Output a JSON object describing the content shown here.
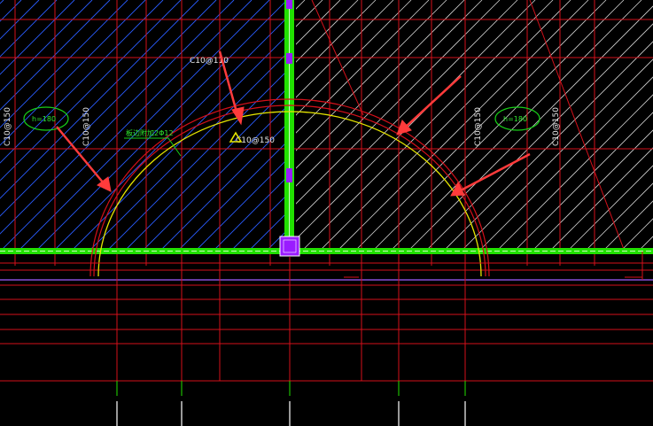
{
  "drawing": {
    "background": "#000000",
    "colors": {
      "grid_line": "#d4101a",
      "hatch_blue": "#2a5cff",
      "hatch_white": "#cfcfcf",
      "wall_green": "#22e000",
      "arc_yellow": "#e6e600",
      "arrow_red": "#ff3b3b",
      "marker_purple": "#9a1cff",
      "guide_purple": "#a05cff",
      "label_green": "#18d018"
    },
    "labels": {
      "rebar_top": "C10@110",
      "rebar_center": "C10@150",
      "rebar_left_a": "C10@150",
      "rebar_left_b": "C10@150",
      "rebar_right_a": "C10@150",
      "rebar_right_b": "C10@150",
      "slab_left": "h=180",
      "slab_right": "h=180",
      "edge_note": "板边附加2Φ12"
    },
    "icons": {
      "center_marker": "triangle-icon",
      "column_marker": "square-icon",
      "annotation_arrows": "arrow-icon"
    }
  }
}
